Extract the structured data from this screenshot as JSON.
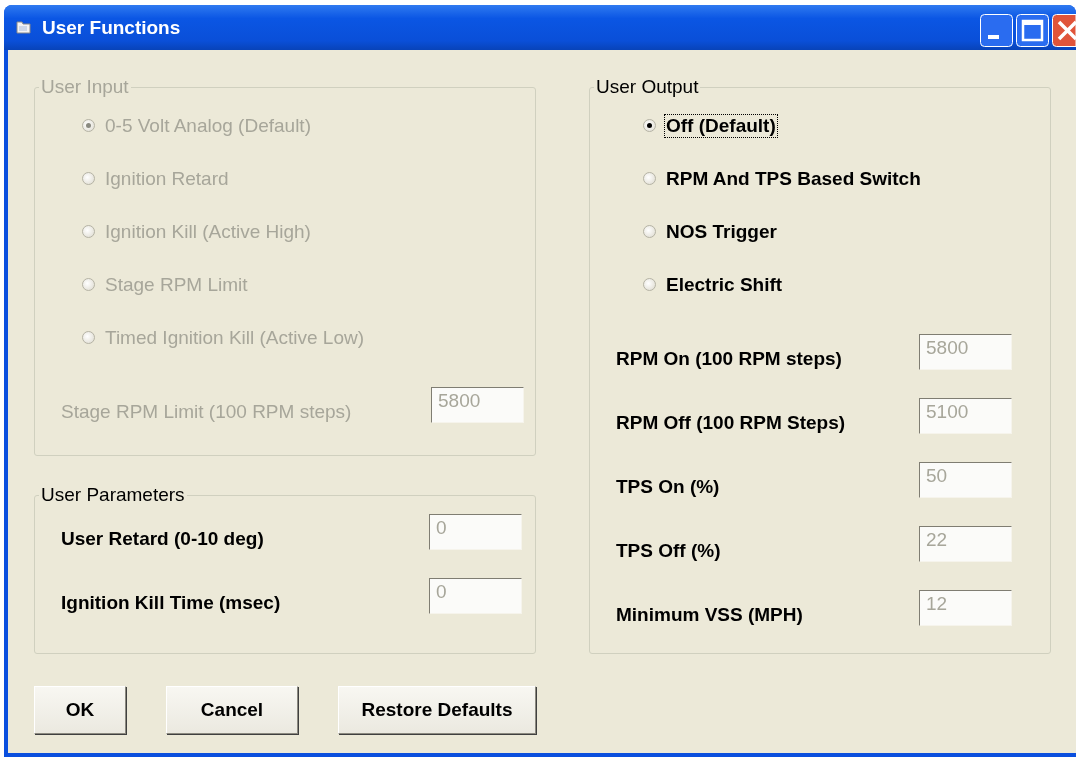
{
  "window": {
    "title": "User Functions"
  },
  "user_input": {
    "title": "User Input",
    "disabled": true,
    "options": [
      {
        "label": "0-5 Volt Analog (Default)",
        "selected": true,
        "focused": false
      },
      {
        "label": "Ignition Retard",
        "selected": false,
        "focused": false
      },
      {
        "label": "Ignition Kill (Active High)",
        "selected": false,
        "focused": false
      },
      {
        "label": "Stage RPM Limit",
        "selected": false,
        "focused": false
      },
      {
        "label": "Timed Ignition Kill (Active Low)",
        "selected": false,
        "focused": false
      }
    ],
    "fields": [
      {
        "label": "Stage RPM Limit (100 RPM steps)",
        "value": "5800",
        "disabled": true
      }
    ]
  },
  "user_parameters": {
    "title": "User Parameters",
    "disabled": false,
    "fields": [
      {
        "label": "User Retard (0-10 deg)",
        "value": "0",
        "disabled": true
      },
      {
        "label": "Ignition Kill Time (msec)",
        "value": "0",
        "disabled": true
      }
    ]
  },
  "user_output": {
    "title": "User Output",
    "disabled": false,
    "options": [
      {
        "label": "Off (Default)",
        "selected": true,
        "focused": true
      },
      {
        "label": "RPM And TPS Based Switch",
        "selected": false,
        "focused": false
      },
      {
        "label": "NOS Trigger",
        "selected": false,
        "focused": false
      },
      {
        "label": "Electric Shift",
        "selected": false,
        "focused": false
      }
    ],
    "fields": [
      {
        "label": "RPM On (100 RPM steps)",
        "value": "5800",
        "disabled": true
      },
      {
        "label": "RPM Off (100 RPM Steps)",
        "value": "5100",
        "disabled": true
      },
      {
        "label": "TPS On (%)",
        "value": "50",
        "disabled": true
      },
      {
        "label": "TPS Off (%)",
        "value": "22",
        "disabled": true
      },
      {
        "label": "Minimum VSS (MPH)",
        "value": "12",
        "disabled": true
      }
    ]
  },
  "buttons": [
    "OK",
    "Cancel",
    "Restore Defaults"
  ]
}
